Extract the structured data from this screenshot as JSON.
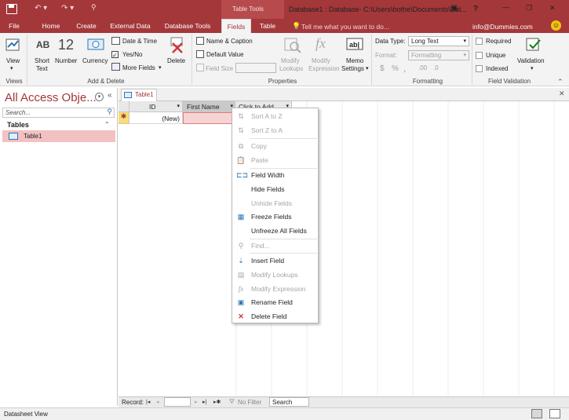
{
  "title_bar": {
    "save_icon": "save-icon",
    "contextual_group": "Table Tools",
    "window_title": "Database1 : Database- C:\\Users\\bothe\\Documents\\Dat...",
    "help": "?",
    "min": "—",
    "restore": "❐",
    "close": "✕"
  },
  "tabs": [
    "File",
    "Home",
    "Create",
    "External Data",
    "Database Tools",
    "Fields",
    "Table"
  ],
  "active_tab": "Fields",
  "tell_me": "Tell me what you want to do...",
  "account": "info@Dummies.com",
  "ribbon": {
    "views": {
      "view_label": "View",
      "group": "Views"
    },
    "add_delete": {
      "short_text_top": "Short",
      "short_text_bottom": "Text",
      "short_text_glyph": "AB",
      "number_glyph": "12",
      "number": "Number",
      "currency": "Currency",
      "date_time": "Date & Time",
      "yes_no": "Yes/No",
      "more_fields": "More Fields",
      "delete": "Delete",
      "group": "Add & Delete"
    },
    "properties": {
      "name_caption": "Name & Caption",
      "default_value": "Default Value",
      "field_size": "Field Size",
      "modify_lookups_1": "Modify",
      "modify_lookups_2": "Lookups",
      "modify_expression_1": "Modify",
      "modify_expression_2": "Expression",
      "memo_settings_1": "Memo",
      "memo_settings_2": "Settings",
      "group": "Properties"
    },
    "formatting": {
      "data_type_label": "Data Type:",
      "data_type_value": "Long Text",
      "format_label": "Format:",
      "format_value": "Formatting",
      "dollar": "$",
      "percent": "%",
      "comma": ",",
      "group": "Formatting"
    },
    "validation": {
      "required": "Required",
      "unique": "Unique",
      "indexed": "Indexed",
      "validation": "Validation",
      "group": "Field Validation"
    }
  },
  "nav": {
    "title": "All Access Obje...",
    "search_placeholder": "Search...",
    "section": "Tables",
    "items": [
      "Table1"
    ]
  },
  "doc_tab": "Table1",
  "grid": {
    "columns": [
      "ID",
      "First Name",
      "Click to Add"
    ],
    "new_row_id": "(New)",
    "new_row_marker": "✱"
  },
  "context_menu": [
    {
      "label": "Sort A to Z",
      "icon": "sort-az-icon",
      "enabled": false
    },
    {
      "label": "Sort Z to A",
      "icon": "sort-za-icon",
      "enabled": false
    },
    {
      "label": "Copy",
      "icon": "copy-icon",
      "enabled": false
    },
    {
      "label": "Paste",
      "icon": "paste-icon",
      "enabled": false
    },
    {
      "label": "Field Width",
      "icon": "field-width-icon",
      "enabled": true
    },
    {
      "label": "Hide Fields",
      "icon": "",
      "enabled": true
    },
    {
      "label": "Unhide Fields",
      "icon": "",
      "enabled": false
    },
    {
      "label": "Freeze Fields",
      "icon": "freeze-icon",
      "enabled": true
    },
    {
      "label": "Unfreeze All Fields",
      "icon": "",
      "enabled": true
    },
    {
      "label": "Find...",
      "icon": "find-icon",
      "enabled": false
    },
    {
      "label": "Insert Field",
      "icon": "insert-field-icon",
      "enabled": true
    },
    {
      "label": "Modify Lookups",
      "icon": "modify-lookups-icon",
      "enabled": false
    },
    {
      "label": "Modify Expression",
      "icon": "fx-icon",
      "enabled": false
    },
    {
      "label": "Rename Field",
      "icon": "rename-icon",
      "enabled": true
    },
    {
      "label": "Delete Field",
      "icon": "delete-field-icon",
      "enabled": true
    }
  ],
  "record_nav": {
    "label": "Record:",
    "first": "|◂",
    "prev": "◂",
    "next": "▸",
    "last": "▸|",
    "new": "▸✱",
    "filter": "No Filter",
    "search": "Search"
  },
  "status": {
    "text": "Datasheet View"
  },
  "colors": {
    "accent": "#a4373a",
    "selected": "#f3c1c1"
  }
}
